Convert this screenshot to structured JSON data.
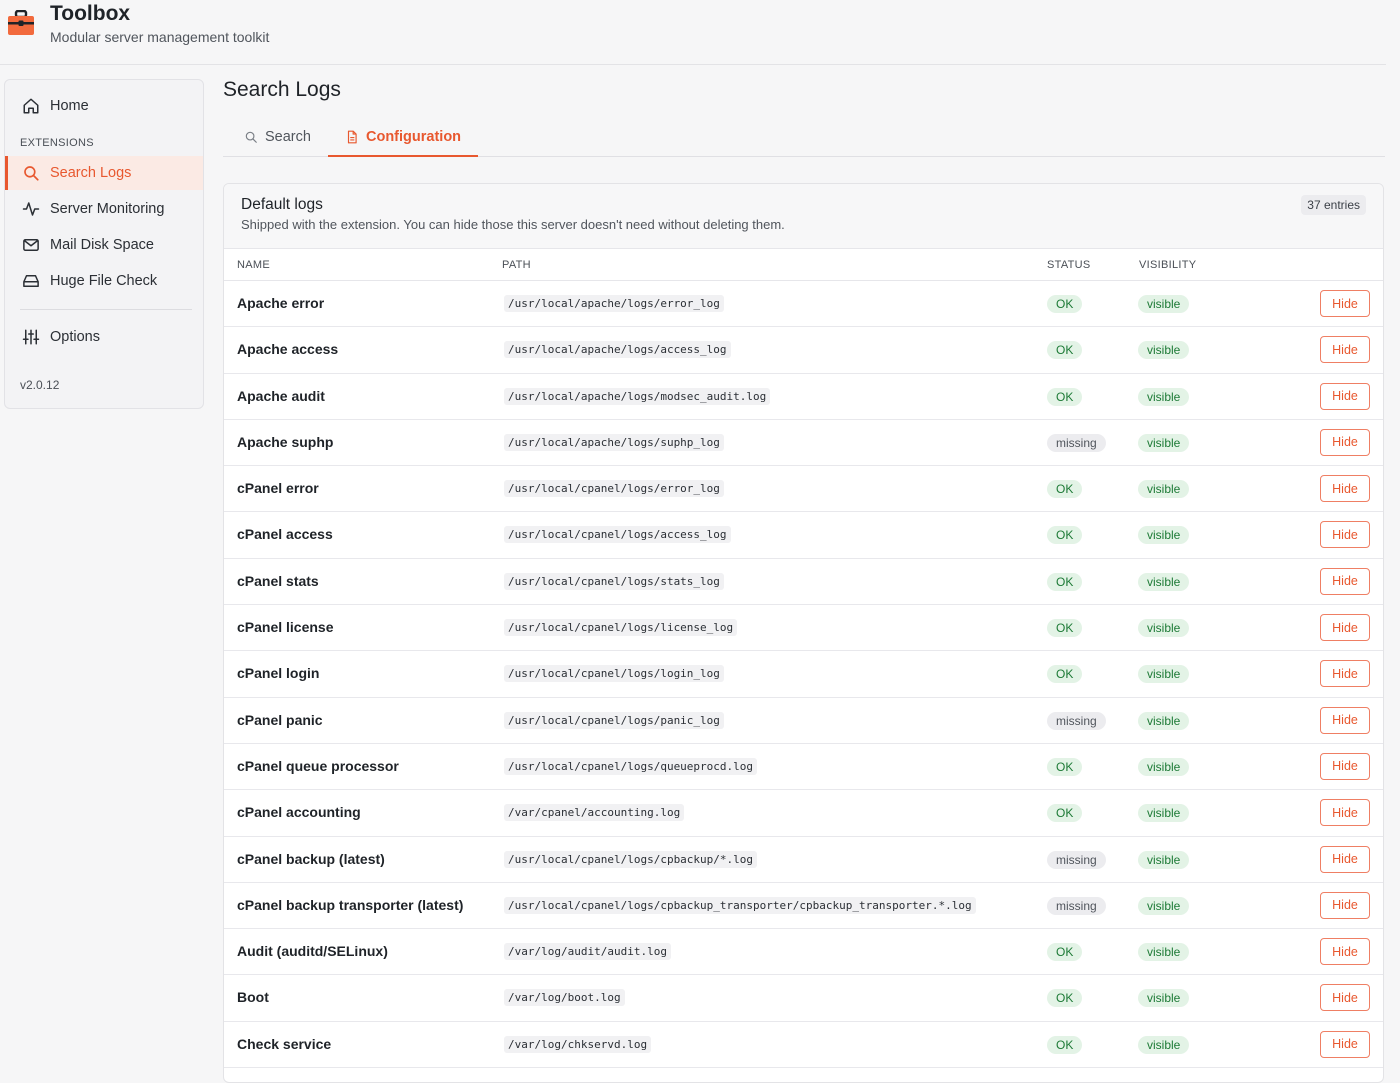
{
  "app": {
    "title": "Toolbox",
    "subtitle": "Modular server management toolkit",
    "accent_color": "#e8582f"
  },
  "sidebar": {
    "home": {
      "label": "Home",
      "icon": "home-icon"
    },
    "section_label": "EXTENSIONS",
    "items": [
      {
        "label": "Search Logs",
        "icon": "search-icon",
        "active": true
      },
      {
        "label": "Server Monitoring",
        "icon": "activity-icon"
      },
      {
        "label": "Mail Disk Space",
        "icon": "mail-icon"
      },
      {
        "label": "Huge File Check",
        "icon": "hard-drive-icon"
      }
    ],
    "options": {
      "label": "Options",
      "icon": "sliders-icon"
    },
    "version": "v2.0.12"
  },
  "main": {
    "title": "Search Logs",
    "tabs": [
      {
        "label": "Search",
        "icon": "search-icon",
        "active": false
      },
      {
        "label": "Configuration",
        "icon": "file-icon",
        "active": true
      }
    ]
  },
  "card": {
    "title": "Default logs",
    "description": "Shipped with the extension. You can hide those this server doesn't need without deleting them.",
    "entries_badge": "37 entries",
    "columns": [
      "NAME",
      "PATH",
      "STATUS",
      "VISIBILITY"
    ],
    "hide_label": "Hide",
    "rows": [
      {
        "name": "Apache error",
        "path": "/usr/local/apache/logs/error_log",
        "status": "OK",
        "visibility": "visible"
      },
      {
        "name": "Apache access",
        "path": "/usr/local/apache/logs/access_log",
        "status": "OK",
        "visibility": "visible"
      },
      {
        "name": "Apache audit",
        "path": "/usr/local/apache/logs/modsec_audit.log",
        "status": "OK",
        "visibility": "visible"
      },
      {
        "name": "Apache suphp",
        "path": "/usr/local/apache/logs/suphp_log",
        "status": "missing",
        "visibility": "visible"
      },
      {
        "name": "cPanel error",
        "path": "/usr/local/cpanel/logs/error_log",
        "status": "OK",
        "visibility": "visible"
      },
      {
        "name": "cPanel access",
        "path": "/usr/local/cpanel/logs/access_log",
        "status": "OK",
        "visibility": "visible"
      },
      {
        "name": "cPanel stats",
        "path": "/usr/local/cpanel/logs/stats_log",
        "status": "OK",
        "visibility": "visible"
      },
      {
        "name": "cPanel license",
        "path": "/usr/local/cpanel/logs/license_log",
        "status": "OK",
        "visibility": "visible"
      },
      {
        "name": "cPanel login",
        "path": "/usr/local/cpanel/logs/login_log",
        "status": "OK",
        "visibility": "visible"
      },
      {
        "name": "cPanel panic",
        "path": "/usr/local/cpanel/logs/panic_log",
        "status": "missing",
        "visibility": "visible"
      },
      {
        "name": "cPanel queue processor",
        "path": "/usr/local/cpanel/logs/queueprocd.log",
        "status": "OK",
        "visibility": "visible"
      },
      {
        "name": "cPanel accounting",
        "path": "/var/cpanel/accounting.log",
        "status": "OK",
        "visibility": "visible"
      },
      {
        "name": "cPanel backup (latest)",
        "path": "/usr/local/cpanel/logs/cpbackup/*.log",
        "status": "missing",
        "visibility": "visible"
      },
      {
        "name": "cPanel backup transporter (latest)",
        "path": "/usr/local/cpanel/logs/cpbackup_transporter/cpbackup_transporter.*.log",
        "status": "missing",
        "visibility": "visible"
      },
      {
        "name": "Audit (auditd/SELinux)",
        "path": "/var/log/audit/audit.log",
        "status": "OK",
        "visibility": "visible"
      },
      {
        "name": "Boot",
        "path": "/var/log/boot.log",
        "status": "OK",
        "visibility": "visible"
      },
      {
        "name": "Check service",
        "path": "/var/log/chkservd.log",
        "status": "OK",
        "visibility": "visible"
      }
    ]
  }
}
